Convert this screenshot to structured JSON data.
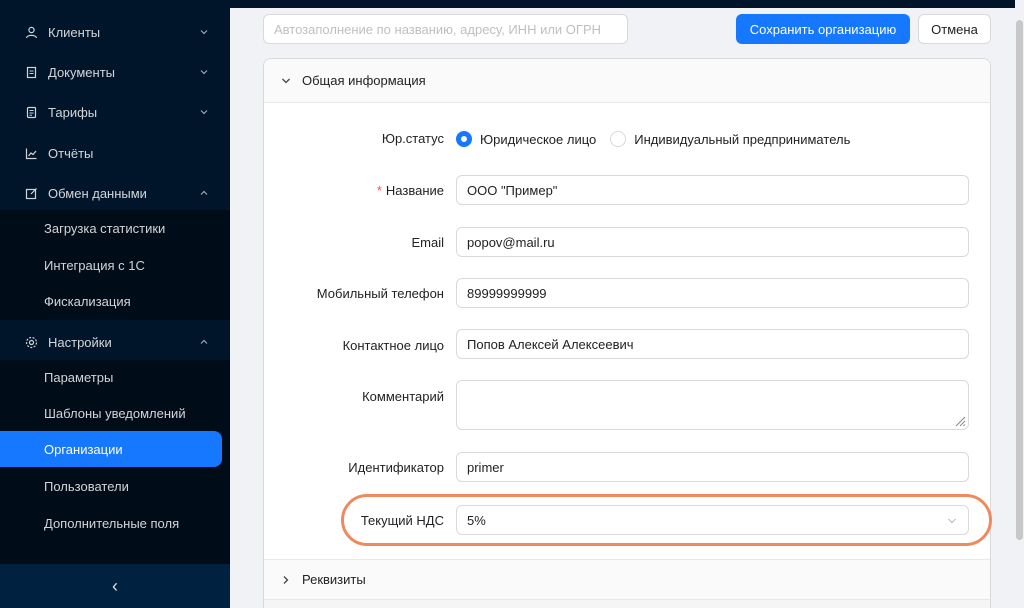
{
  "sidebar": {
    "items": [
      {
        "label": "Клиенты",
        "icon": "user-icon"
      },
      {
        "label": "Документы",
        "icon": "document-icon"
      },
      {
        "label": "Тарифы",
        "icon": "file-icon"
      },
      {
        "label": "Отчёты",
        "icon": "chart-icon"
      },
      {
        "label": "Обмен данными",
        "icon": "edit-icon"
      },
      {
        "label": "Настройки",
        "icon": "gear-icon"
      }
    ],
    "exchange_sub": [
      "Загрузка статистики",
      "Интеграция с 1С",
      "Фискализация"
    ],
    "settings_sub": [
      "Параметры",
      "Шаблоны уведомлений",
      "Организации",
      "Пользователи",
      "Дополнительные поля"
    ],
    "active_item": "Организации",
    "collapse_glyph": "‹"
  },
  "toolbar": {
    "autofill_placeholder": "Автозаполнение по названию, адресу, ИНН или ОГРН",
    "save_label": "Сохранить организацию",
    "cancel_label": "Отмена"
  },
  "panel": {
    "title": "Общая информация",
    "details_title": "Реквизиты"
  },
  "form": {
    "legal_status_label": "Юр.статус",
    "legal_status_options": [
      "Юридическое лицо",
      "Индивидуальный предприниматель"
    ],
    "legal_status_selected": "Юридическое лицо",
    "name_label": "Название",
    "name_required_mark": "*",
    "name_value": "ООО \"Пример\"",
    "email_label": "Email",
    "email_value": "popov@mail.ru",
    "phone_label": "Мобильный телефон",
    "phone_value": "89999999999",
    "contact_label": "Контактное лицо",
    "contact_value": "Попов Алексей Алексеевич",
    "comment_label": "Комментарий",
    "comment_value": "",
    "identifier_label": "Идентификатор",
    "identifier_value": "primer",
    "vat_label": "Текущий НДС",
    "vat_value": "5%"
  },
  "colors": {
    "sidebar_bg": "#001529",
    "submenu_bg": "#000c17",
    "accent": "#1677ff",
    "highlight_ring": "#f08a5d",
    "required": "#ff4d4f"
  }
}
